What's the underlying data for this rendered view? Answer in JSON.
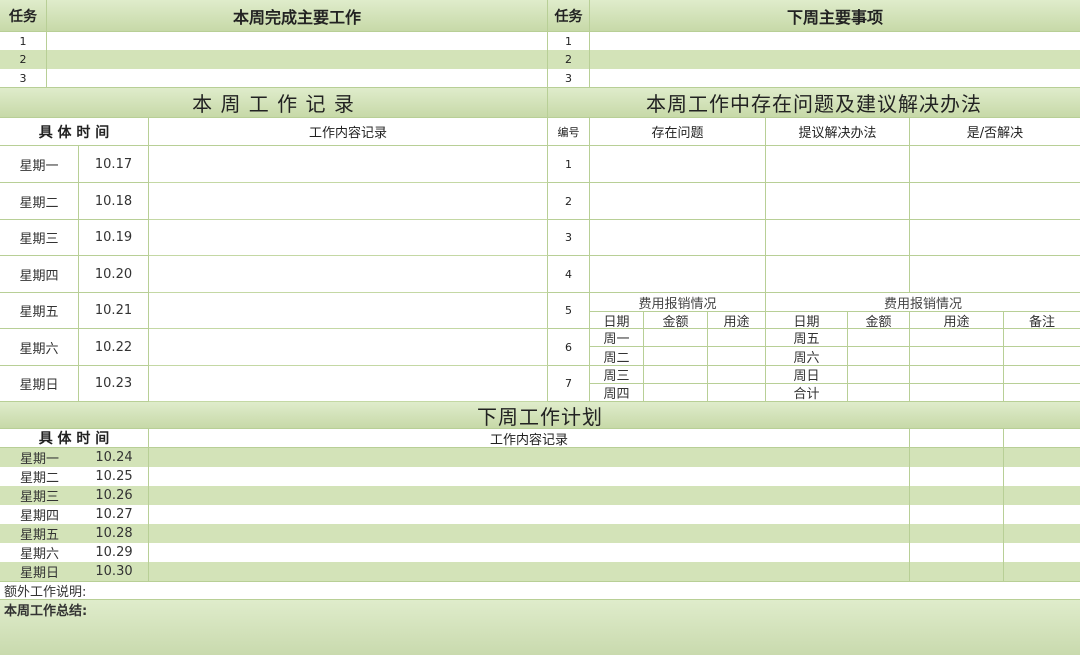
{
  "top": {
    "task_label_left": "任务",
    "this_week_done": "本周完成主要工作",
    "task_label_right": "任务",
    "next_week_items": "下周主要事项",
    "row_numbers": [
      "1",
      "2",
      "3"
    ]
  },
  "records": {
    "title": "本 周 工 作 记 录",
    "col_time": "具 体 时 间",
    "col_content": "工作内容记录",
    "days": [
      {
        "day": "星期一",
        "date": "10.17"
      },
      {
        "day": "星期二",
        "date": "10.18"
      },
      {
        "day": "星期三",
        "date": "10.19"
      },
      {
        "day": "星期四",
        "date": "10.20"
      },
      {
        "day": "星期五",
        "date": "10.21"
      },
      {
        "day": "星期六",
        "date": "10.22"
      },
      {
        "day": "星期日",
        "date": "10.23"
      }
    ]
  },
  "issues": {
    "title": "本周工作中存在问题及建议解决办法",
    "col_no": "编号",
    "col_issue": "存在问题",
    "col_solution": "提议解决办法",
    "col_resolved": "是/否解决",
    "numbers": [
      "1",
      "2",
      "3",
      "4",
      "5",
      "6",
      "7"
    ]
  },
  "expense": {
    "title_left": "费用报销情况",
    "title_right": "费用报销情况",
    "left_headers": [
      "日期",
      "金额",
      "用途"
    ],
    "right_headers": [
      "日期",
      "金额",
      "用途",
      "备注"
    ],
    "left_days": [
      "周一",
      "周二",
      "周三",
      "周四"
    ],
    "right_days": [
      "周五",
      "周六",
      "周日",
      "合计"
    ]
  },
  "plan": {
    "title": "下周工作计划",
    "col_time": "具 体 时 间",
    "col_content": "工作内容记录",
    "days": [
      {
        "day": "星期一",
        "date": "10.24"
      },
      {
        "day": "星期二",
        "date": "10.25"
      },
      {
        "day": "星期三",
        "date": "10.26"
      },
      {
        "day": "星期四",
        "date": "10.27"
      },
      {
        "day": "星期五",
        "date": "10.28"
      },
      {
        "day": "星期六",
        "date": "10.29"
      },
      {
        "day": "星期日",
        "date": "10.30"
      }
    ]
  },
  "footer": {
    "extra_label": "额外工作说明:",
    "summary_label": "本周工作总结:"
  }
}
